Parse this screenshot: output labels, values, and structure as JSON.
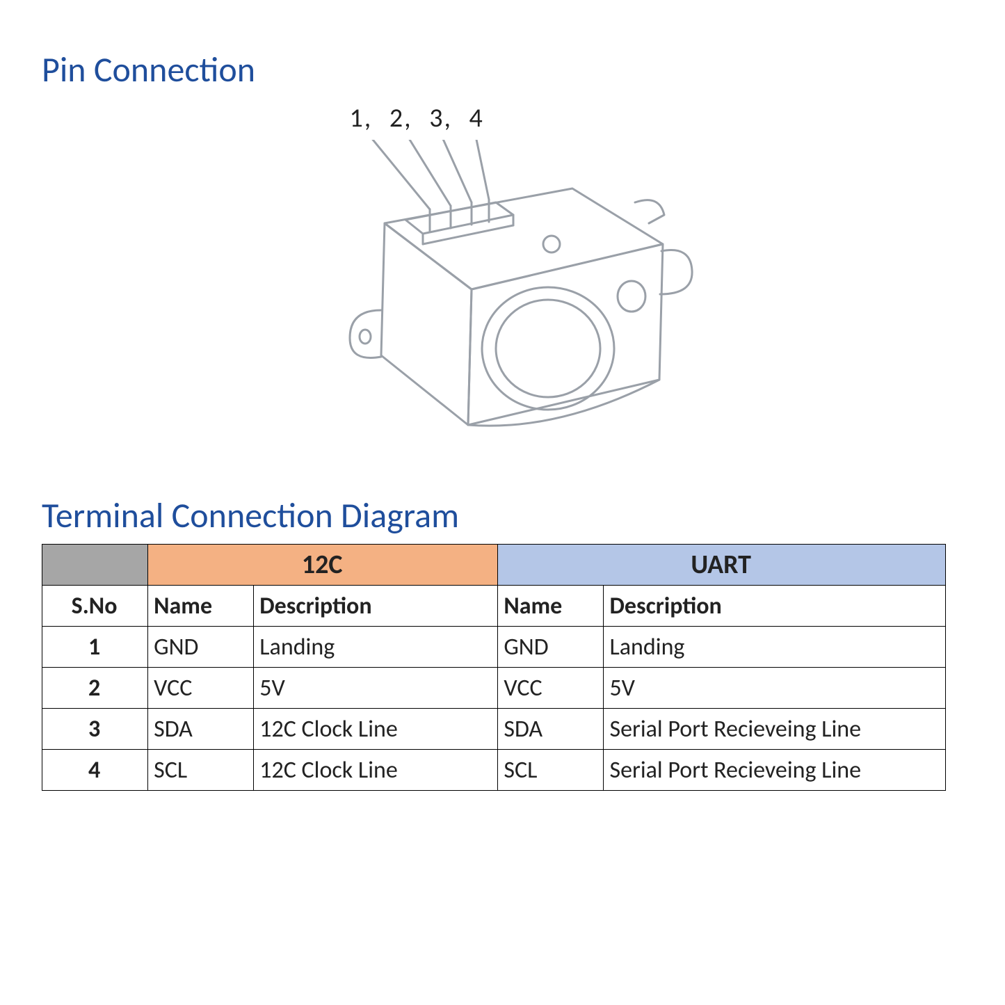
{
  "headings": {
    "pin": "Pin Connection",
    "term": "Terminal Connection Diagram"
  },
  "pins": {
    "p1": "1,",
    "p2": "2,",
    "p3": "3,",
    "p4": "4"
  },
  "table": {
    "col12c": "12C",
    "coluart": "UART",
    "sub": {
      "sno": "S.No",
      "name": "Name",
      "desc": "Description"
    },
    "rows": [
      {
        "sno": "1",
        "n1": "GND",
        "d1": "Landing",
        "n2": "GND",
        "d2": "Landing"
      },
      {
        "sno": "2",
        "n1": "VCC",
        "d1": "5V",
        "n2": "VCC",
        "d2": "5V"
      },
      {
        "sno": "3",
        "n1": "SDA",
        "d1": "12C Clock Line",
        "n2": "SDA",
        "d2": "Serial Port Recieveing Line"
      },
      {
        "sno": "4",
        "n1": "SCL",
        "d1": "12C Clock Line",
        "n2": "SCL",
        "d2": "Serial Port Recieveing Line"
      }
    ]
  }
}
